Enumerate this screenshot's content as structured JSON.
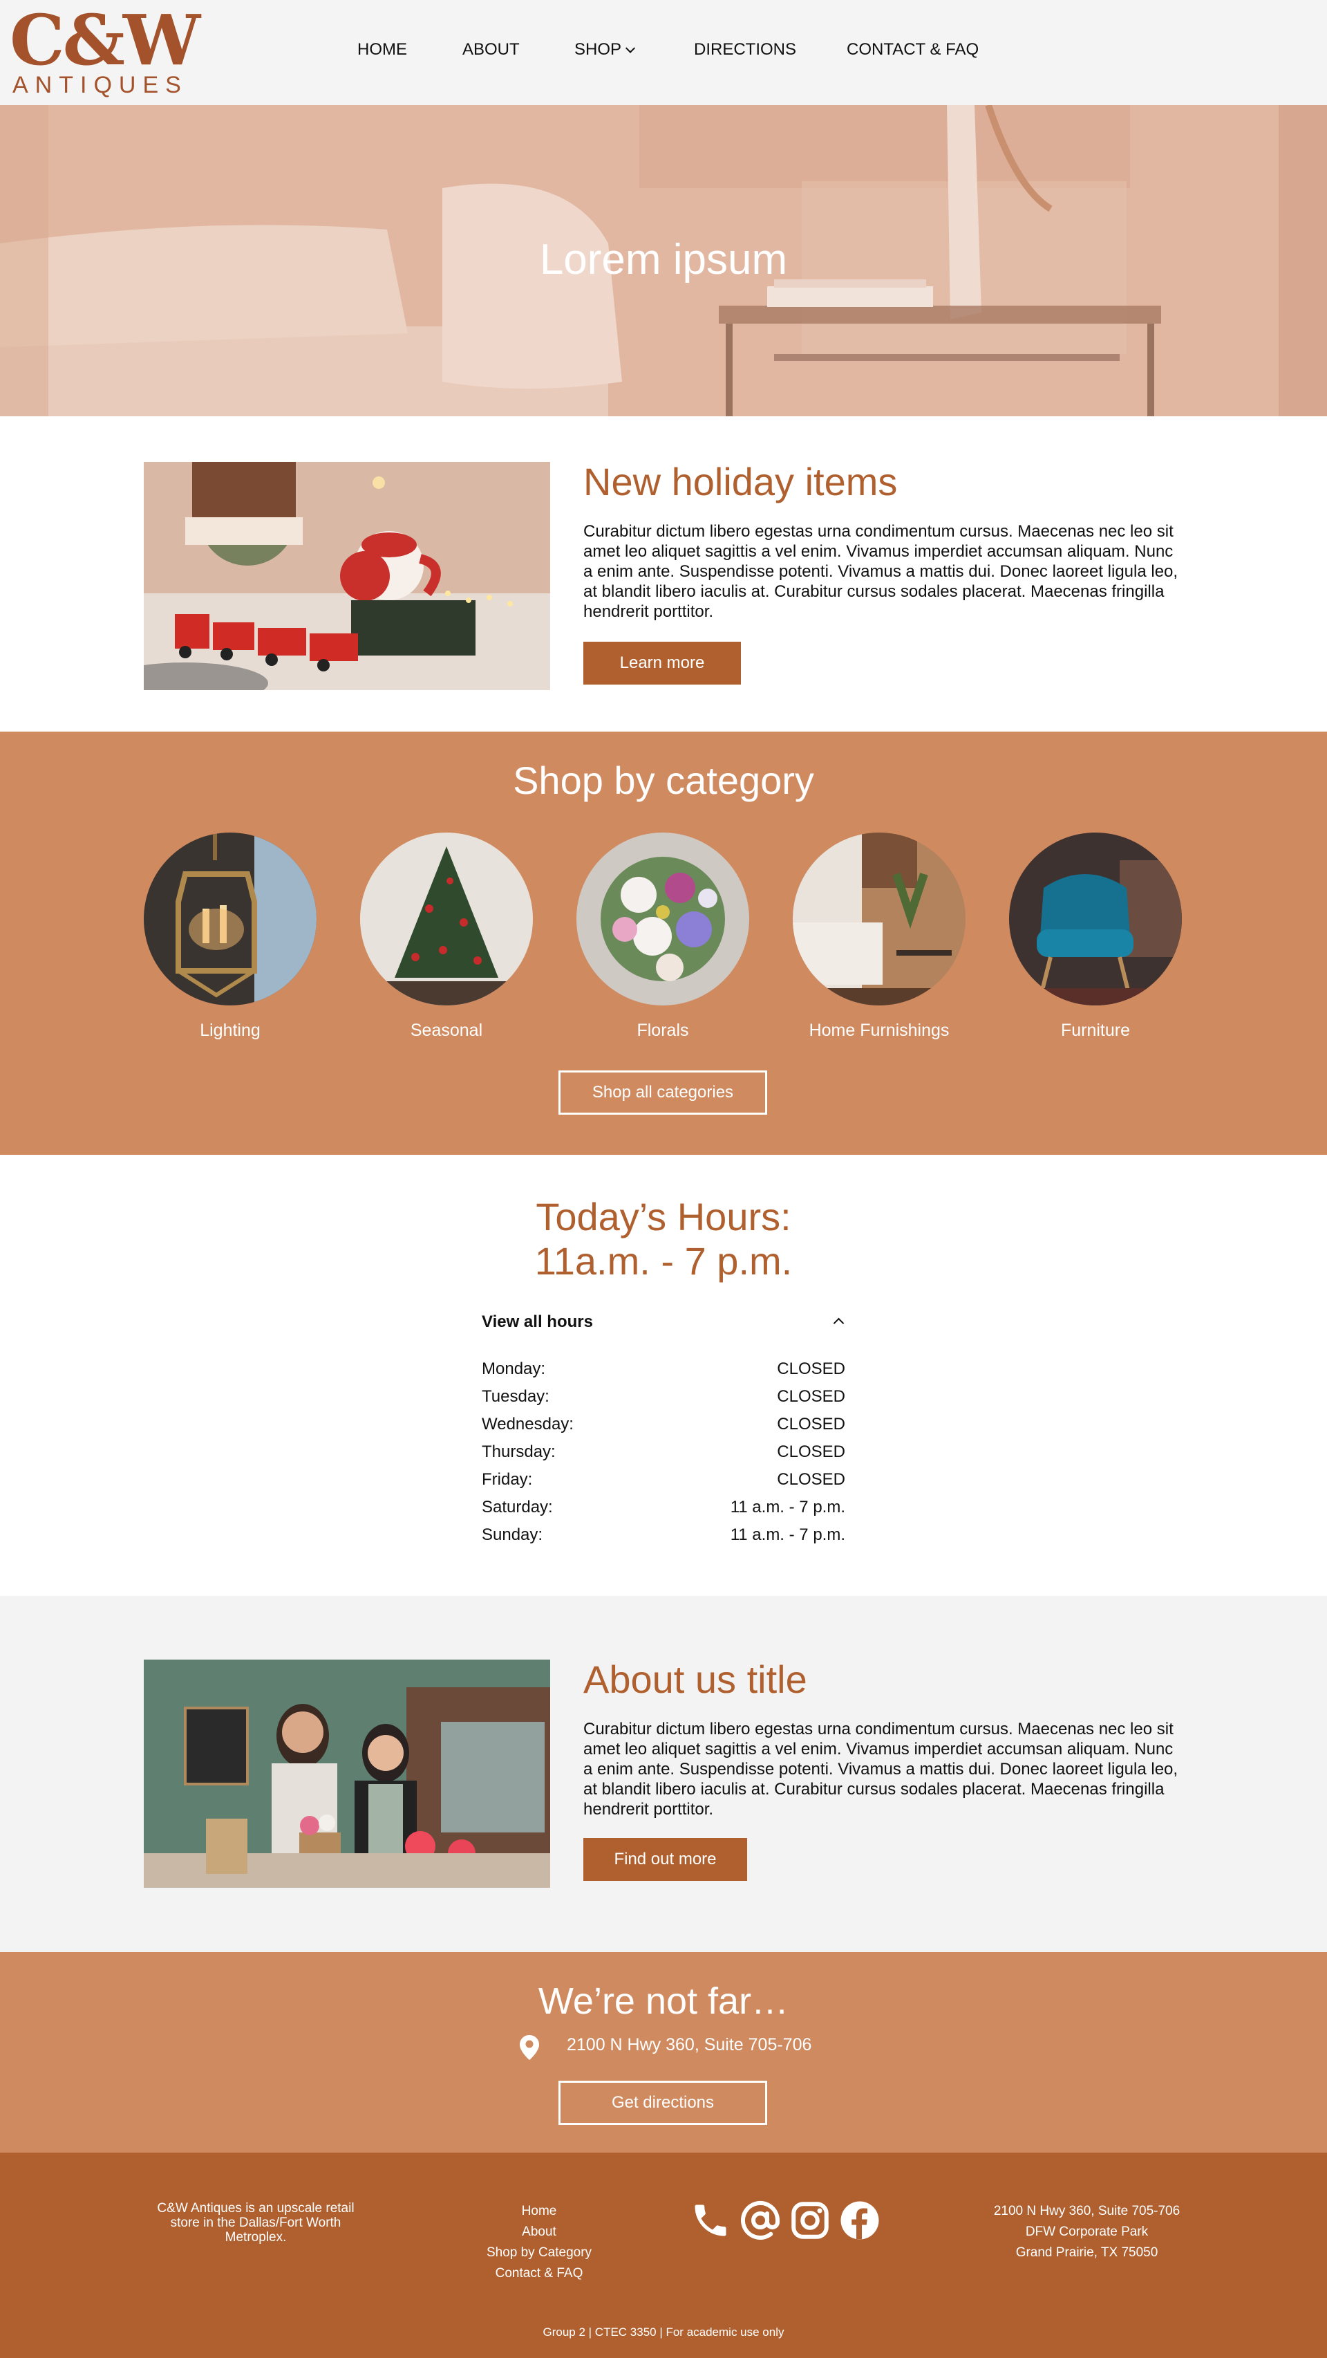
{
  "brand": {
    "logo_main": "C&W",
    "logo_sub": "ANTIQUES",
    "accent": "#b0602f",
    "section_bg": "#d08a60"
  },
  "nav": {
    "items": [
      {
        "label": "HOME"
      },
      {
        "label": "ABOUT"
      },
      {
        "label": "SHOP",
        "icon": "chevron-down-icon"
      },
      {
        "label": "DIRECTIONS"
      },
      {
        "label": "CONTACT & FAQ"
      }
    ]
  },
  "hero": {
    "title": "Lorem ipsum"
  },
  "holiday": {
    "title": "New holiday items",
    "body": "Curabitur dictum libero egestas urna condimentum cursus. Maecenas nec leo sit amet leo aliquet sagittis a vel enim. Vivamus imperdiet accumsan aliquam. Nunc a enim ante. Suspendisse potenti. Vivamus a mattis dui. Donec laoreet ligula leo, at blandit libero iaculis at. Curabitur cursus sodales placerat. Maecenas fringilla hendrerit porttitor.",
    "button": "Learn more"
  },
  "categories": {
    "title": "Shop by category",
    "items": [
      {
        "label": "Lighting"
      },
      {
        "label": "Seasonal"
      },
      {
        "label": "Florals"
      },
      {
        "label": "Home Furnishings"
      },
      {
        "label": "Furniture"
      }
    ],
    "button": "Shop all categories"
  },
  "hours": {
    "title_line1": "Today’s Hours:",
    "title_line2": "11a.m. - 7 p.m.",
    "toggle": "View all hours",
    "rows": [
      {
        "day": "Monday:",
        "value": "CLOSED"
      },
      {
        "day": "Tuesday:",
        "value": "CLOSED"
      },
      {
        "day": "Wednesday:",
        "value": "CLOSED"
      },
      {
        "day": "Thursday:",
        "value": "CLOSED"
      },
      {
        "day": "Friday:",
        "value": "CLOSED"
      },
      {
        "day": "Saturday:",
        "value": "11 a.m. - 7 p.m."
      },
      {
        "day": "Sunday:",
        "value": "11 a.m. - 7 p.m."
      }
    ]
  },
  "about": {
    "title": "About us title",
    "body": "Curabitur dictum libero egestas urna condimentum cursus. Maecenas nec leo sit amet leo aliquet sagittis a vel enim. Vivamus imperdiet accumsan aliquam. Nunc a enim ante. Suspendisse potenti. Vivamus a mattis dui. Donec laoreet ligula leo, at blandit libero iaculis at. Curabitur cursus sodales placerat. Maecenas fringilla hendrerit porttitor.",
    "button": "Find out more"
  },
  "directions": {
    "title": "We’re not far…",
    "address": "2100 N Hwy 360, Suite 705-706",
    "button": "Get directions"
  },
  "footer": {
    "about": "C&W Antiques is an upscale retail store in the Dallas/Fort Worth Metroplex.",
    "links": [
      "Home",
      "About",
      "Shop by Category",
      "Contact & FAQ"
    ],
    "icons": [
      "phone-icon",
      "at-sign-icon",
      "instagram-icon",
      "facebook-icon"
    ],
    "address": [
      "2100 N Hwy 360, Suite 705-706",
      "DFW Corporate Park",
      "Grand Prairie, TX 75050"
    ],
    "bottom": "Group 2 |  CTEC 3350  |   For academic use only"
  }
}
